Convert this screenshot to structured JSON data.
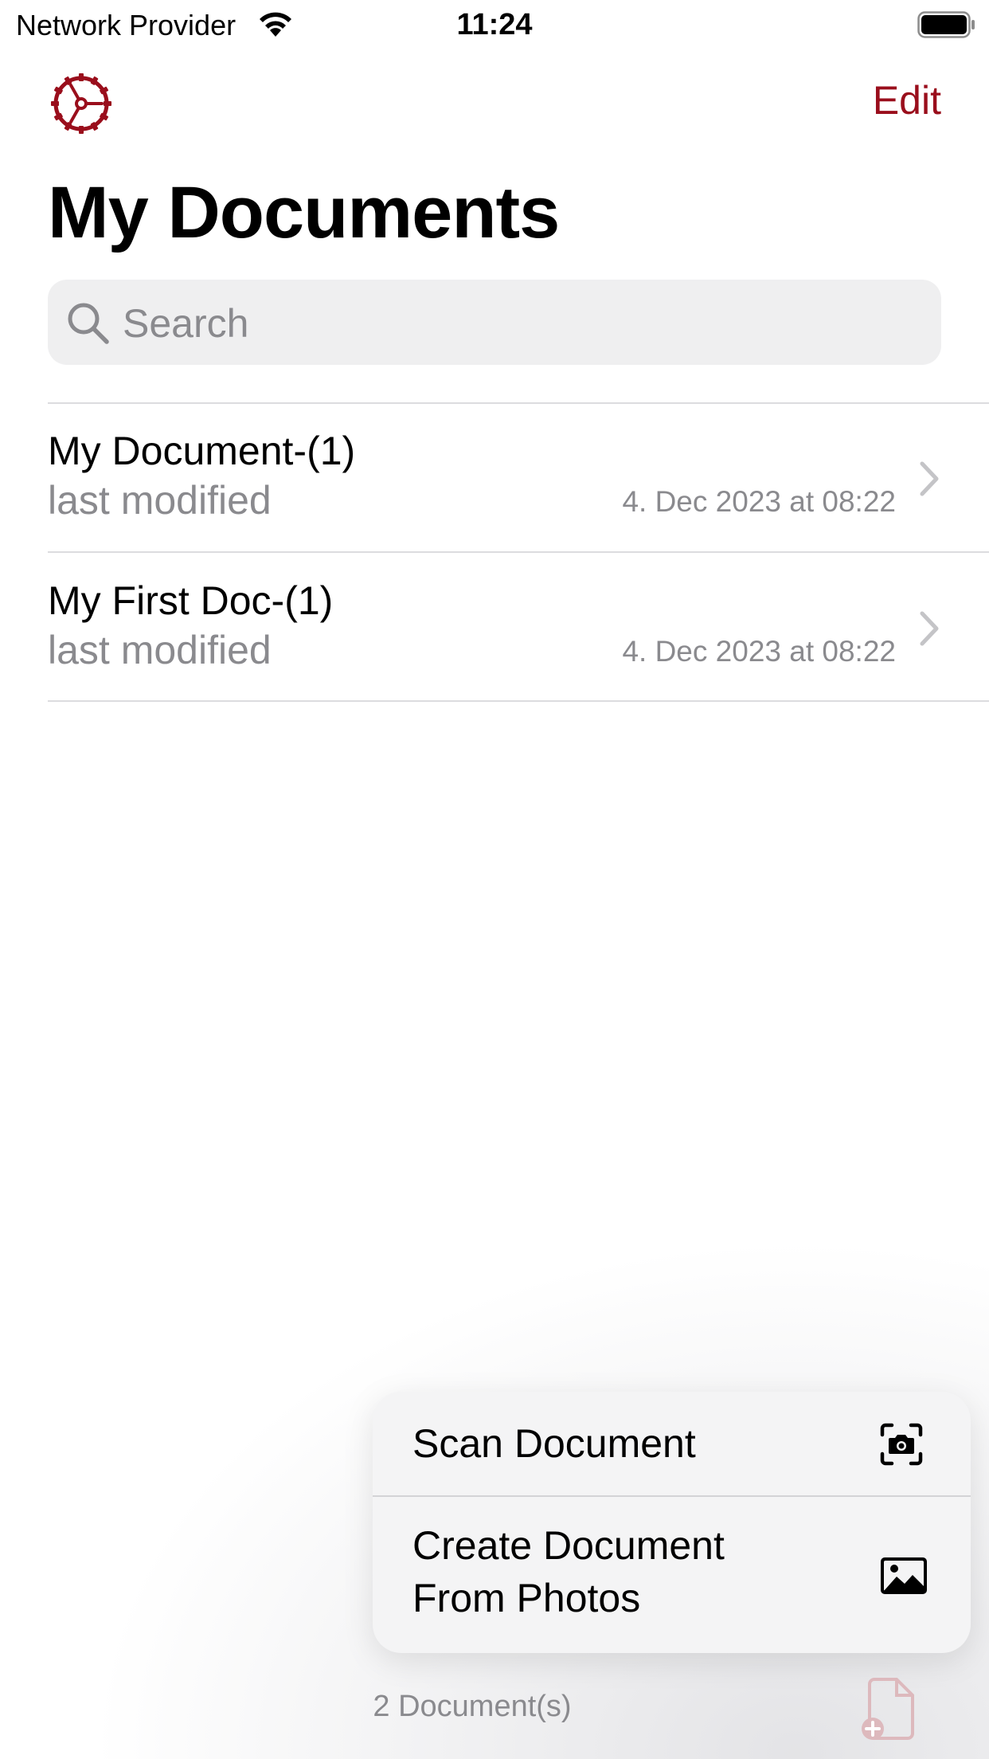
{
  "status_bar": {
    "carrier": "Network Provider",
    "time": "11:24"
  },
  "nav": {
    "edit_label": "Edit",
    "title": "My Documents"
  },
  "search": {
    "placeholder": "Search"
  },
  "documents": [
    {
      "name": "My Document-(1)",
      "subtitle": "last modified",
      "date": "4. Dec 2023 at 08:22"
    },
    {
      "name": "My First Doc-(1)",
      "subtitle": "last modified",
      "date": "4. Dec 2023 at 08:22"
    }
  ],
  "menu": {
    "scan_label": "Scan Document",
    "photos_label_line1": "Create Document",
    "photos_label_line2": "From Photos"
  },
  "footer": {
    "count": "2 Document(s)"
  },
  "colors": {
    "accent": "#9a0e1c",
    "secondary_text": "#8a8a8e",
    "separator": "#dcdcdf"
  },
  "icons": [
    "wifi-icon",
    "battery-icon",
    "gear-icon",
    "search-icon",
    "chevron-right-icon",
    "camera-scan-icon",
    "photo-icon",
    "new-document-icon"
  ]
}
